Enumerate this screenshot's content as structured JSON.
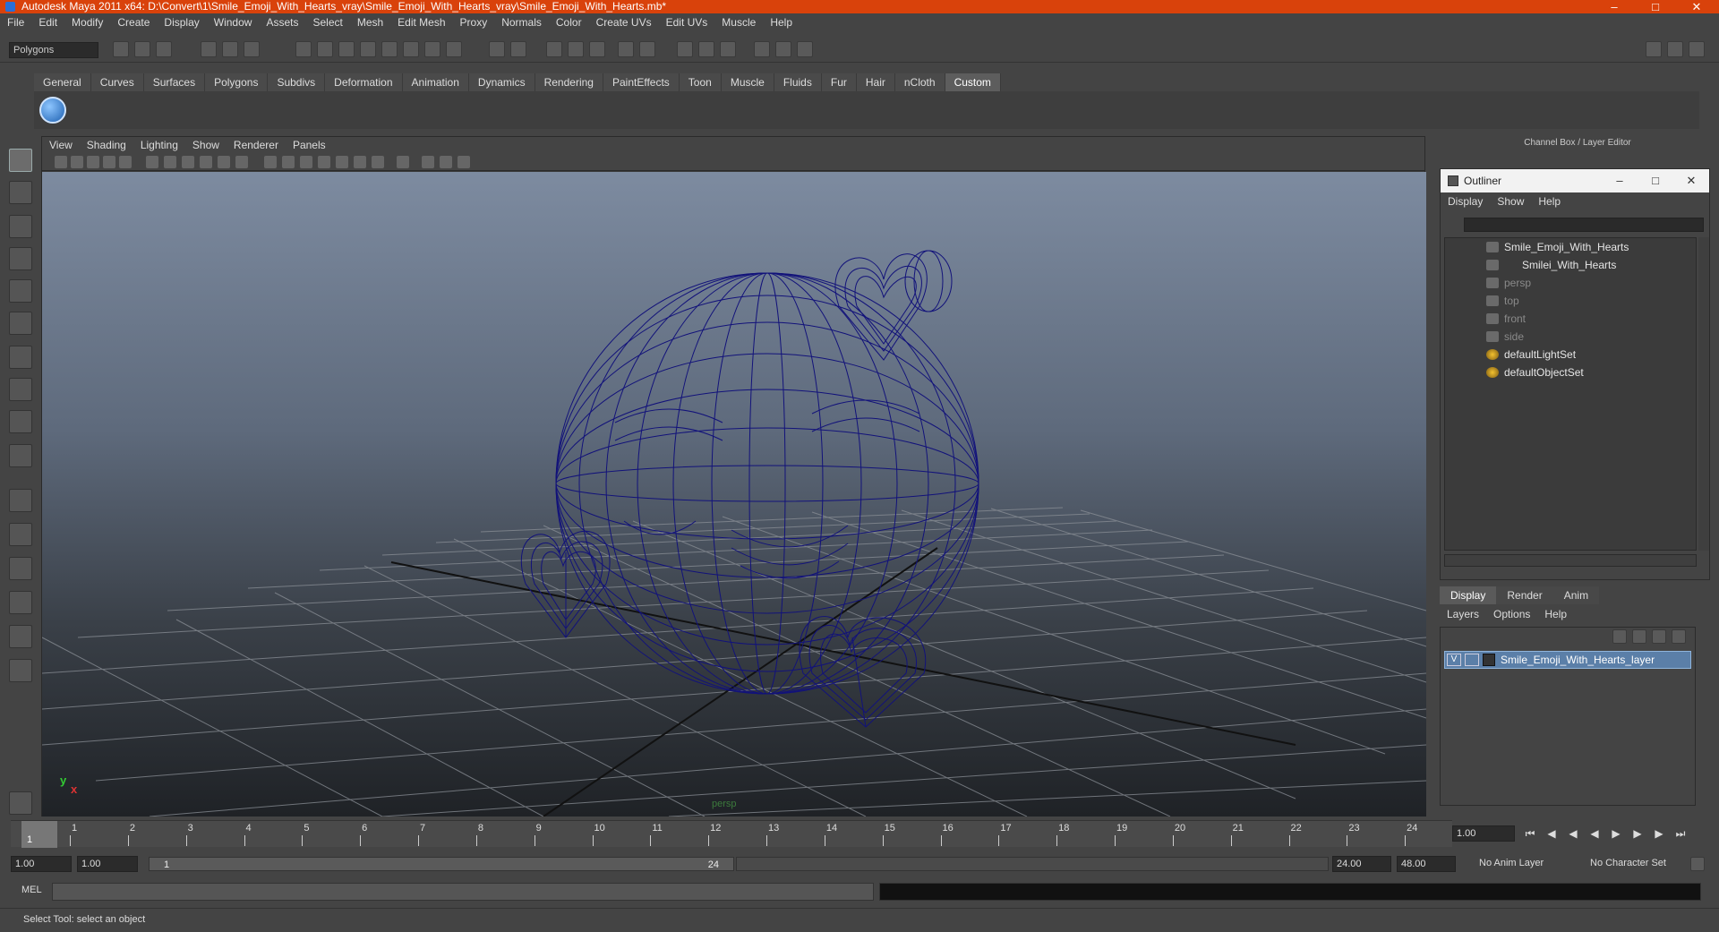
{
  "window": {
    "title": "Autodesk Maya 2011 x64: D:\\Convert\\1\\Smile_Emoji_With_Hearts_vray\\Smile_Emoji_With_Hearts_vray\\Smile_Emoji_With_Hearts.mb*"
  },
  "menubar": [
    "File",
    "Edit",
    "Modify",
    "Create",
    "Display",
    "Window",
    "Assets",
    "Select",
    "Mesh",
    "Edit Mesh",
    "Proxy",
    "Normals",
    "Color",
    "Create UVs",
    "Edit UVs",
    "Muscle",
    "Help"
  ],
  "mode_selector": {
    "value": "Polygons"
  },
  "shelf_tabs": [
    "General",
    "Curves",
    "Surfaces",
    "Polygons",
    "Subdivs",
    "Deformation",
    "Animation",
    "Dynamics",
    "Rendering",
    "PaintEffects",
    "Toon",
    "Muscle",
    "Fluids",
    "Fur",
    "Hair",
    "nCloth",
    "Custom"
  ],
  "active_shelf_tab": "Custom",
  "viewport": {
    "menu": [
      "View",
      "Shading",
      "Lighting",
      "Show",
      "Renderer",
      "Panels"
    ],
    "camera_label": "persp",
    "axis_x": "x",
    "axis_y": "y",
    "wire_color": "#12127a"
  },
  "channel_box": {
    "title": "Channel Box / Layer Editor"
  },
  "outliner": {
    "title": "Outliner",
    "menu": [
      "Display",
      "Show",
      "Help"
    ],
    "items": [
      {
        "label": "Smile_Emoji_With_Hearts",
        "dim": false
      },
      {
        "label": "Smilei_With_Hearts",
        "dim": false
      },
      {
        "label": "persp",
        "dim": true
      },
      {
        "label": "top",
        "dim": true
      },
      {
        "label": "front",
        "dim": true
      },
      {
        "label": "side",
        "dim": true
      },
      {
        "label": "defaultLightSet",
        "dim": false
      },
      {
        "label": "defaultObjectSet",
        "dim": false
      }
    ]
  },
  "layer_editor": {
    "tabs": [
      "Display",
      "Render",
      "Anim"
    ],
    "active_tab": "Display",
    "menu": [
      "Layers",
      "Options",
      "Help"
    ],
    "layer": {
      "visible": "V",
      "name": "Smile_Emoji_With_Hearts_layer"
    }
  },
  "timeline": {
    "frames": [
      "1",
      "2",
      "3",
      "4",
      "5",
      "6",
      "7",
      "8",
      "9",
      "10",
      "11",
      "12",
      "13",
      "14",
      "15",
      "16",
      "17",
      "18",
      "19",
      "20",
      "21",
      "22",
      "23",
      "24"
    ],
    "current_frame": "1",
    "current_time_field": "1.00"
  },
  "range": {
    "start_time": "1.00",
    "playback_start": "1.00",
    "slider_start": "1",
    "slider_end": "24",
    "playback_end": "24.00",
    "end_time": "48.00",
    "anim_layer": "No Anim Layer",
    "character_set": "No Character Set"
  },
  "mel": {
    "label": "MEL"
  },
  "helpline": {
    "text": "Select Tool: select an object"
  }
}
